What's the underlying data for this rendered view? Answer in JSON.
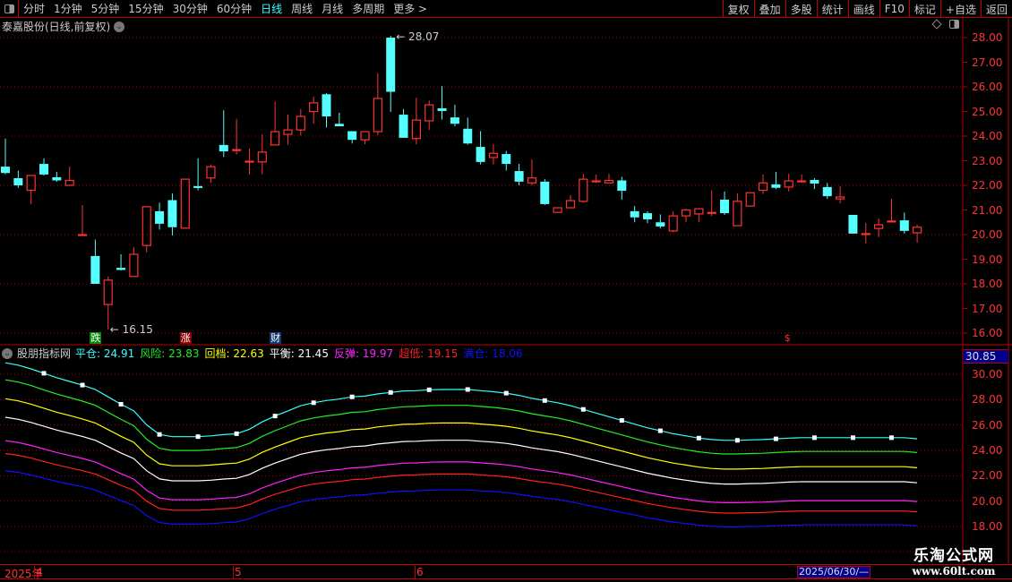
{
  "topbar": {
    "periods": [
      "分时",
      "1分钟",
      "5分钟",
      "15分钟",
      "30分钟",
      "60分钟",
      "日线",
      "周线",
      "月线",
      "多周期",
      "更多 >"
    ],
    "active_period": "日线",
    "buttons": [
      "复权",
      "叠加",
      "多股",
      "统计",
      "画线",
      "F10",
      "标记",
      "+自选",
      "返回"
    ]
  },
  "stock_title": "泰嘉股份(日线,前复权)",
  "annotations": {
    "high_label": "28.07",
    "low_label": "16.15"
  },
  "signals": [
    {
      "text": "跌",
      "candle": 7,
      "bg": "#0a8a0a"
    },
    {
      "text": "涨",
      "candle": 14,
      "bg": "#8b0000"
    },
    {
      "text": "财",
      "candle": 21,
      "bg": "#103a70"
    },
    {
      "text": "$",
      "candle": 61,
      "bg": "transparent"
    }
  ],
  "indicator": {
    "name": "股朋指标网",
    "box_value": "30.85",
    "items": [
      {
        "label": "平仓",
        "value": "24.91",
        "color": "#33ffff",
        "ratio": 1.1613
      },
      {
        "label": "风险",
        "value": "23.83",
        "color": "#22ee22",
        "ratio": 1.111
      },
      {
        "label": "回档",
        "value": "22.63",
        "color": "#ffff00",
        "ratio": 1.055
      },
      {
        "label": "平衡",
        "value": "21.45",
        "color": "#ffffff",
        "ratio": 1.0
      },
      {
        "label": "反弹",
        "value": "19.97",
        "color": "#ff22ff",
        "ratio": 0.931
      },
      {
        "label": "超低",
        "value": "19.15",
        "color": "#ff2020",
        "ratio": 0.8928
      },
      {
        "label": "满仓",
        "value": "18.06",
        "color": "#1010ff",
        "ratio": 0.842
      }
    ]
  },
  "date_axis": {
    "year": "2025年",
    "months": [
      "4",
      "5",
      "6"
    ],
    "cursor_date": "2025/06/30/—"
  },
  "watermark": {
    "line1": "乐淘公式网",
    "line2": "www.60lt.com"
  },
  "colors": {
    "up": "#ff3333",
    "down": "#55ffff",
    "grid": "#aa0000"
  },
  "chart_data": [
    {
      "type": "candlestick",
      "title": "泰嘉股份(日线,前复权)",
      "ylim": [
        15.7,
        28.6
      ],
      "y_ticks": [
        "28.00",
        "27.00",
        "26.00",
        "25.00",
        "24.00",
        "23.00",
        "22.00",
        "21.00",
        "20.00",
        "19.00",
        "18.00",
        "17.00",
        "16.00"
      ],
      "ohlc": [
        [
          22.76,
          23.9,
          22.45,
          22.5
        ],
        [
          22.29,
          22.6,
          21.9,
          22.0
        ],
        [
          21.8,
          22.4,
          21.24,
          22.4
        ],
        [
          22.87,
          23.1,
          22.4,
          22.44
        ],
        [
          22.33,
          22.55,
          22.15,
          22.2
        ],
        [
          22.0,
          22.76,
          22.0,
          22.2
        ],
        [
          20.0,
          21.2,
          20.0,
          20.0
        ],
        [
          19.13,
          19.8,
          18.0,
          18.0
        ],
        [
          17.16,
          18.3,
          16.15,
          18.15
        ],
        [
          18.65,
          19.2,
          18.55,
          18.6
        ],
        [
          18.3,
          19.5,
          18.3,
          19.2
        ],
        [
          19.56,
          21.13,
          19.27,
          21.13
        ],
        [
          20.95,
          21.3,
          20.2,
          20.44
        ],
        [
          21.4,
          21.67,
          19.96,
          20.3
        ],
        [
          20.26,
          22.25,
          20.26,
          22.25
        ],
        [
          21.97,
          23.1,
          21.8,
          21.93
        ],
        [
          22.3,
          22.85,
          22.1,
          22.76
        ],
        [
          23.64,
          25.05,
          23.15,
          23.38
        ],
        [
          23.45,
          24.7,
          23.25,
          23.45
        ],
        [
          22.98,
          23.5,
          22.44,
          22.98
        ],
        [
          22.95,
          24.07,
          22.45,
          23.35
        ],
        [
          23.64,
          25.4,
          23.64,
          24.18
        ],
        [
          24.07,
          24.87,
          23.65,
          24.25
        ],
        [
          24.25,
          25.1,
          24.03,
          24.8
        ],
        [
          25.0,
          25.6,
          24.5,
          25.35
        ],
        [
          25.7,
          25.75,
          24.35,
          24.8
        ],
        [
          24.5,
          24.95,
          24.4,
          24.4
        ],
        [
          24.2,
          24.2,
          23.7,
          23.85
        ],
        [
          23.85,
          24.18,
          23.67,
          24.18
        ],
        [
          24.18,
          26.55,
          24.03,
          25.53
        ],
        [
          28.0,
          28.07,
          24.98,
          25.8
        ],
        [
          24.87,
          25.1,
          23.93,
          23.93
        ],
        [
          23.9,
          25.56,
          23.67,
          24.65
        ],
        [
          24.62,
          25.45,
          24.25,
          25.27
        ],
        [
          25.13,
          26.03,
          24.67,
          25.02
        ],
        [
          24.76,
          25.27,
          24.4,
          24.5
        ],
        [
          24.3,
          24.75,
          23.65,
          23.7
        ],
        [
          23.56,
          24.2,
          22.85,
          22.95
        ],
        [
          23.13,
          23.67,
          22.85,
          23.3
        ],
        [
          23.27,
          23.4,
          22.6,
          22.87
        ],
        [
          22.58,
          22.87,
          22.0,
          22.15
        ],
        [
          22.1,
          23.05,
          22.0,
          22.3
        ],
        [
          22.15,
          22.25,
          21.2,
          21.24
        ],
        [
          20.9,
          21.09,
          20.9,
          21.09
        ],
        [
          21.09,
          21.6,
          21.09,
          21.38
        ],
        [
          21.35,
          22.47,
          21.3,
          22.25
        ],
        [
          22.18,
          22.44,
          22.1,
          22.18
        ],
        [
          22.1,
          22.47,
          22.1,
          22.2
        ],
        [
          22.2,
          22.35,
          21.42,
          21.78
        ],
        [
          20.95,
          21.16,
          20.5,
          20.7
        ],
        [
          20.87,
          20.95,
          20.47,
          20.62
        ],
        [
          20.5,
          20.82,
          20.25,
          20.33
        ],
        [
          20.15,
          20.95,
          20.1,
          20.76
        ],
        [
          20.76,
          21.05,
          20.5,
          21.0
        ],
        [
          20.84,
          21.05,
          20.5,
          21.05
        ],
        [
          20.9,
          21.8,
          20.75,
          20.9
        ],
        [
          21.42,
          21.75,
          20.8,
          20.87
        ],
        [
          20.36,
          21.67,
          20.36,
          21.35
        ],
        [
          21.16,
          21.7,
          21.16,
          21.7
        ],
        [
          21.8,
          22.44,
          21.65,
          22.1
        ],
        [
          22.04,
          22.55,
          21.85,
          21.9
        ],
        [
          21.93,
          22.47,
          21.75,
          22.18
        ],
        [
          22.18,
          22.44,
          22.1,
          22.18
        ],
        [
          22.22,
          22.29,
          21.85,
          22.07
        ],
        [
          21.93,
          22.1,
          21.45,
          21.56
        ],
        [
          21.45,
          21.96,
          21.27,
          21.53
        ],
        [
          20.8,
          20.8,
          20.04,
          20.04
        ],
        [
          20.04,
          20.47,
          19.63,
          20.04
        ],
        [
          20.25,
          20.65,
          19.9,
          20.4
        ],
        [
          20.55,
          21.45,
          20.5,
          20.55
        ],
        [
          20.58,
          20.9,
          20.04,
          20.15
        ],
        [
          20.07,
          20.4,
          19.67,
          20.3
        ]
      ]
    },
    {
      "type": "line",
      "title": "股朋指标网",
      "ylim": [
        17.5,
        31.0
      ],
      "y_ticks": [
        "30.00",
        "28.00",
        "26.00",
        "24.00",
        "22.00",
        "20.00",
        "18.00"
      ],
      "base_series_name": "平衡",
      "base_series": [
        26.61,
        26.45,
        26.2,
        25.9,
        25.6,
        25.35,
        25.1,
        24.8,
        24.3,
        23.8,
        23.35,
        22.4,
        21.75,
        21.6,
        21.6,
        21.6,
        21.65,
        21.74,
        21.8,
        22.1,
        22.6,
        23.0,
        23.35,
        23.7,
        23.9,
        24.05,
        24.15,
        24.3,
        24.35,
        24.5,
        24.6,
        24.7,
        24.72,
        24.78,
        24.8,
        24.8,
        24.8,
        24.72,
        24.65,
        24.55,
        24.4,
        24.2,
        24.05,
        23.9,
        23.7,
        23.45,
        23.2,
        22.95,
        22.7,
        22.45,
        22.2,
        22.0,
        21.8,
        21.65,
        21.5,
        21.4,
        21.35,
        21.35,
        21.38,
        21.4,
        21.45,
        21.5,
        21.53,
        21.53,
        21.53,
        21.53,
        21.53,
        21.53,
        21.53,
        21.53,
        21.53,
        21.45
      ]
    }
  ]
}
